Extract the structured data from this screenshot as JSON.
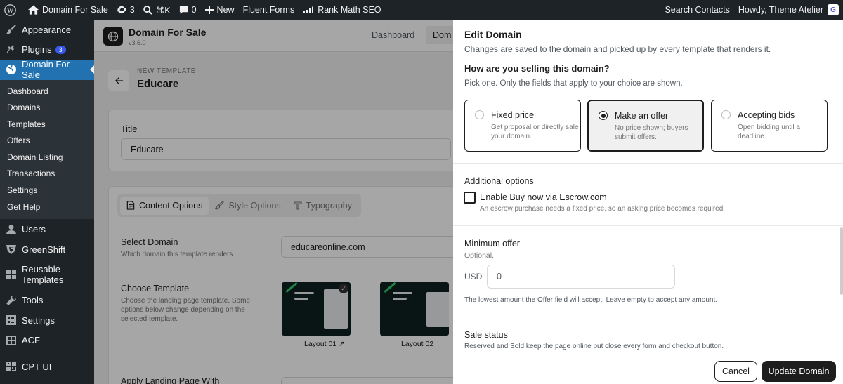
{
  "adminbar": {
    "site": "Domain For Sale",
    "updates": "3",
    "search_shortcut": "⌘K",
    "comments": "0",
    "new": "New",
    "fluent": "Fluent Forms",
    "rankmath": "Rank Math SEO",
    "search_contacts": "Search Contacts",
    "howdy": "Howdy, Theme Atelier"
  },
  "sidebar": {
    "appearance": "Appearance",
    "plugins": "Plugins",
    "plugins_badge": "3",
    "active": "Domain For Sale",
    "sub": [
      "Dashboard",
      "Domains",
      "Templates",
      "Offers",
      "Domain Listing",
      "Transactions",
      "Settings",
      "Get Help"
    ],
    "users": "Users",
    "greenshift": "GreenShift",
    "reusable": "Reusable Templates",
    "tools": "Tools",
    "settings": "Settings",
    "acf": "ACF",
    "cptui": "CPT UI"
  },
  "plugin": {
    "name": "Domain For Sale",
    "version": "v3.6.0",
    "tab_dashboard": "Dashboard",
    "tab_domains": "Dom",
    "new_template": "NEW TEMPLATE",
    "template_name": "Educare",
    "title_label": "Title",
    "title_value": "Educare",
    "tab_content": "Content Options",
    "tab_style": "Style Options",
    "tab_typography": "Typography",
    "select_domain_label": "Select Domain",
    "select_domain_help": "Which domain this template renders.",
    "select_domain_value": "educareonline.com",
    "choose_template_label": "Choose Template",
    "choose_template_help": "Choose the landing page template. Some options below change depending on the selected template.",
    "layout1": "Layout 01",
    "layout2": "Layout 02",
    "apply_landing": "Apply Landing Page With"
  },
  "drawer": {
    "title": "Edit Domain",
    "subtitle": "Changes are saved to the domain and picked up by every template that renders it.",
    "selling_title": "How are you selling this domain?",
    "selling_sub": "Pick one. Only the fields that apply to your choice are shown.",
    "options": [
      {
        "title": "Fixed price",
        "desc": "Get proposal or directly sale your domain."
      },
      {
        "title": "Make an offer",
        "desc": "No price shown; buyers submit offers."
      },
      {
        "title": "Accepting bids",
        "desc": "Open bidding until a deadline."
      }
    ],
    "additional_title": "Additional options",
    "escrow_label": "Enable Buy now via Escrow.com",
    "escrow_help": "An escrow purchase needs a fixed price, so an asking price becomes required.",
    "min_offer_title": "Minimum offer",
    "min_offer_optional": "Optional.",
    "currency": "USD",
    "min_offer_value": "0",
    "min_offer_help": "The lowest amount the Offer field will accept. Leave empty to accept any amount.",
    "sale_status_title": "Sale status",
    "sale_status_help": "Reserved and Sold keep the page online but close every form and checkout button.",
    "cancel": "Cancel",
    "update": "Update Domain"
  }
}
